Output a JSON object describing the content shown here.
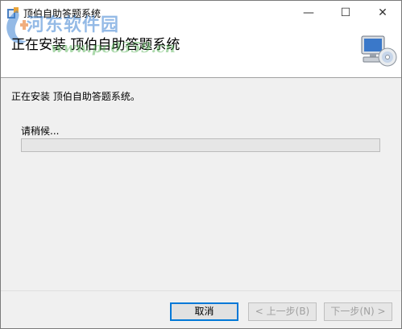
{
  "window": {
    "title": "顶伯自助答题系统",
    "controls": {
      "minimize": "—",
      "maximize": "☐",
      "close": "✕"
    }
  },
  "banner": {
    "title": "正在安装 顶伯自助答题系统",
    "watermark_name": "河东软件园",
    "watermark_url": "www.pc0359.cn",
    "icon": "computer-cd-icon"
  },
  "content": {
    "status_message": "正在安装 顶伯自助答题系统。",
    "wait_label": "请稍候...",
    "progress": 0
  },
  "buttons": {
    "cancel": "取消",
    "back": "< 上一步(B)",
    "next": "下一步(N) >"
  },
  "colors": {
    "accent": "#0078d7",
    "progress_fill": "#06b025"
  }
}
